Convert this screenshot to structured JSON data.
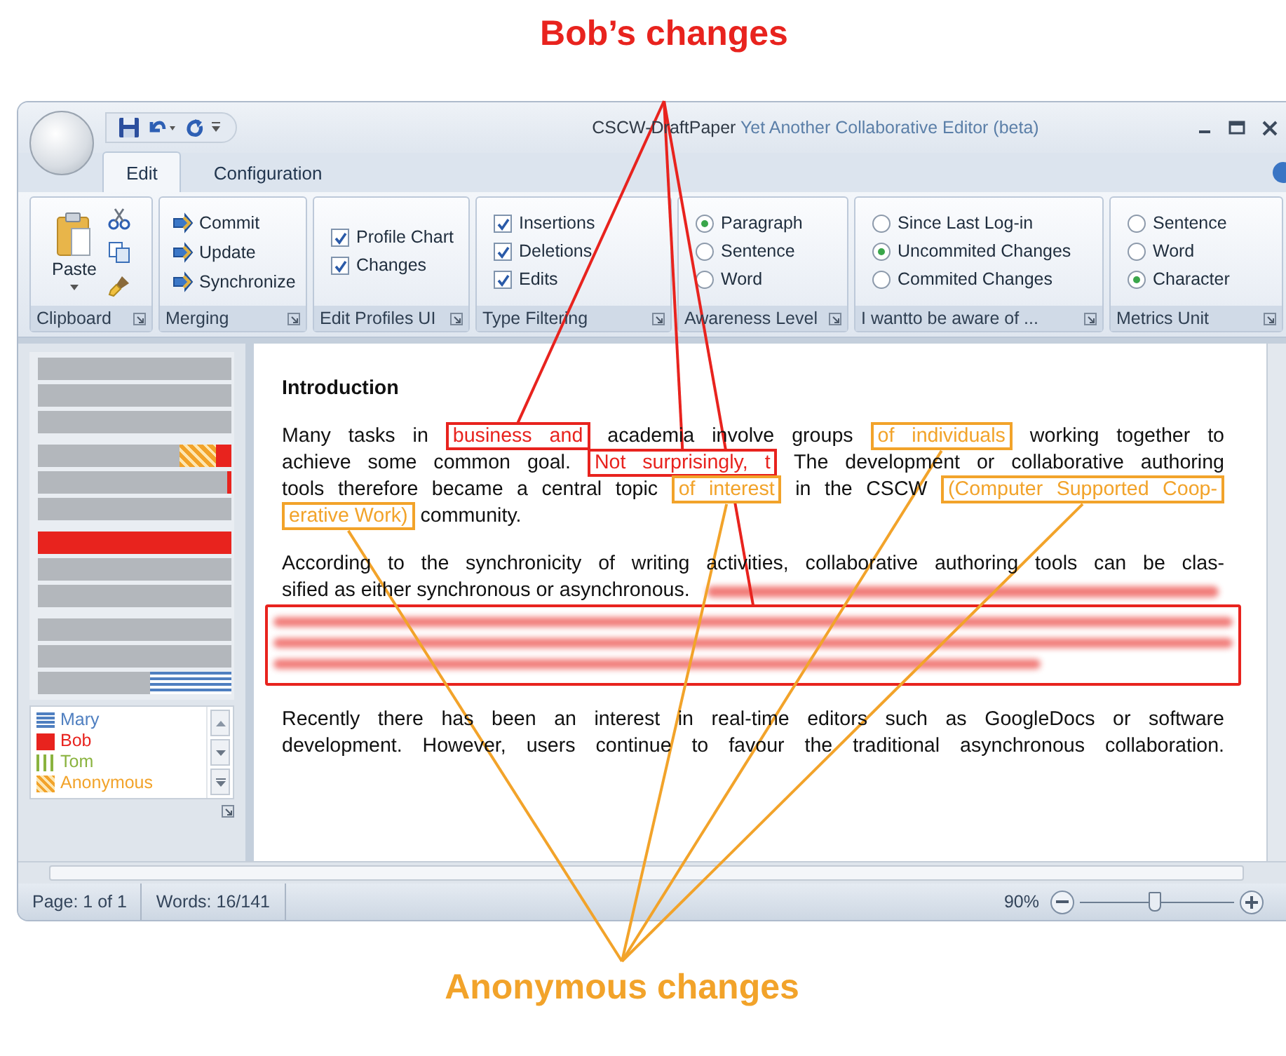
{
  "captions": {
    "top": {
      "text": "Bob’s changes",
      "kind": "bob"
    },
    "bottom": {
      "text": "Anonymous changes",
      "kind": "anonymous"
    }
  },
  "window": {
    "document_title": "CSCW-DraftPaper",
    "app_title": "Yet Another Collaborative Editor (beta)"
  },
  "tabs": [
    {
      "label": "Edit",
      "selected": true
    },
    {
      "label": "Configuration",
      "selected": false
    }
  ],
  "ribbon": {
    "groups": [
      {
        "label": "Clipboard",
        "kind": "clipboard",
        "items": [
          {
            "label": "Paste"
          }
        ]
      },
      {
        "label": "Merging",
        "kind": "buttons",
        "items": [
          {
            "label": "Commit"
          },
          {
            "label": "Update"
          },
          {
            "label": "Synchronize"
          }
        ]
      },
      {
        "label": "Edit Profiles UI",
        "kind": "checks",
        "items": [
          {
            "label": "Profile Chart",
            "checked": true
          },
          {
            "label": "Changes",
            "checked": true
          }
        ]
      },
      {
        "label": "Type Filtering",
        "kind": "checks",
        "items": [
          {
            "label": "Insertions",
            "checked": true
          },
          {
            "label": "Deletions",
            "checked": true
          },
          {
            "label": "Edits",
            "checked": true
          }
        ]
      },
      {
        "label": "Awareness Level",
        "kind": "radios",
        "items": [
          {
            "label": "Paragraph",
            "selected": true
          },
          {
            "label": "Sentence",
            "selected": false
          },
          {
            "label": "Word",
            "selected": false
          }
        ]
      },
      {
        "label": "I wantto be aware of ...",
        "kind": "radios",
        "items": [
          {
            "label": "Since Last Log-in",
            "selected": false
          },
          {
            "label": "Uncommited Changes",
            "selected": true
          },
          {
            "label": "Commited Changes",
            "selected": false
          }
        ]
      },
      {
        "label": "Metrics Unit",
        "kind": "radios",
        "items": [
          {
            "label": "Sentence",
            "selected": false
          },
          {
            "label": "Word",
            "selected": false
          },
          {
            "label": "Character",
            "selected": true
          }
        ]
      }
    ]
  },
  "profile_legend": [
    {
      "label": "Mary",
      "kind": "mary",
      "color": "#4f7fc0"
    },
    {
      "label": "Bob",
      "kind": "bob",
      "color": "#e8231e"
    },
    {
      "label": "Tom",
      "kind": "tom",
      "color": "#8ab33f"
    },
    {
      "label": "Anonymous",
      "kind": "anonymous",
      "color": "#f2a32a"
    }
  ],
  "document": {
    "heading": "Introduction",
    "paragraphs": [
      {
        "lines": [
          {
            "segments": [
              {
                "text": "Many tasks in"
              },
              {
                "text": "business and",
                "kind": "bob"
              },
              {
                "text": "academia involve groups"
              },
              {
                "text": "of individuals",
                "kind": "anonymous"
              },
              {
                "text": "working together to"
              }
            ]
          },
          {
            "segments": [
              {
                "text": "achieve some common goal."
              },
              {
                "text": "Not surprisingly, t",
                "kind": "bob"
              },
              {
                "text": "The development or collaborative authoring"
              }
            ]
          },
          {
            "segments": [
              {
                "text": "tools therefore became a central topic"
              },
              {
                "text": "of interest",
                "kind": "anonymous"
              },
              {
                "text": "in the CSCW"
              },
              {
                "text": "(Computer Supported Coop-",
                "kind": "anonymous"
              }
            ]
          },
          {
            "segments": [
              {
                "text": "erative Work)",
                "kind": "anonymous"
              },
              {
                "text": "community."
              }
            ]
          }
        ]
      },
      {
        "lines": [
          {
            "segments": [
              {
                "text": "According to the synchronicity of writing activities, collaborative authoring tools can be clas-"
              }
            ]
          },
          {
            "segments": [
              {
                "text": "sified as either synchronous or asynchronous."
              }
            ]
          }
        ],
        "deletion": {
          "kind": "bob"
        }
      },
      {
        "lines": [
          {
            "segments": [
              {
                "text": "Recently there has been an interest in real-time editors such as GoogleDocs or software"
              }
            ]
          },
          {
            "segments": [
              {
                "text": "development. However, users continue to favour the traditional asynchronous collaboration."
              }
            ]
          }
        ]
      }
    ]
  },
  "status_bar": {
    "page": "Page: 1 of 1",
    "words": "Words: 16/141",
    "zoom": "90%",
    "zoom_slider": {
      "level": 0.48
    }
  }
}
